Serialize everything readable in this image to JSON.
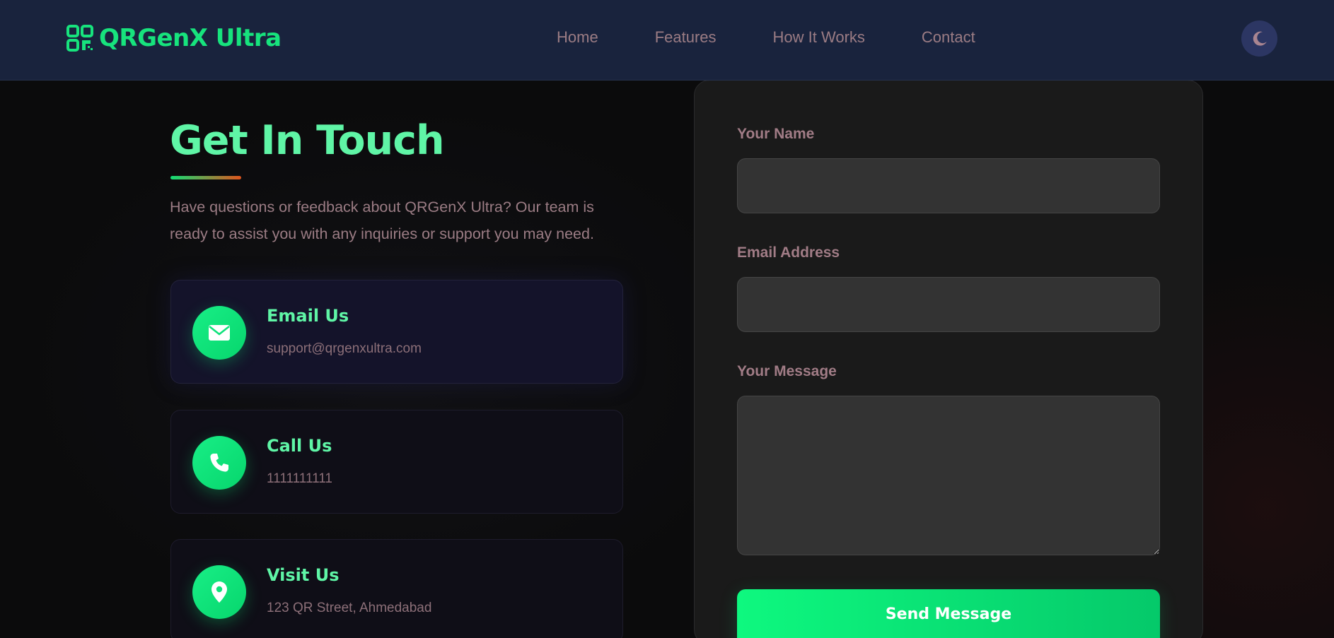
{
  "navbar": {
    "brand": "QRGenX Ultra",
    "links": [
      "Home",
      "Features",
      "How It Works",
      "Contact"
    ],
    "theme_toggle_icon": "moon-icon"
  },
  "contact": {
    "title": "Get In Touch",
    "intro": "Have questions or feedback about QRGenX Ultra? Our team is ready to assist you with any inquiries or support you may need.",
    "cards": [
      {
        "icon": "envelope-icon",
        "title": "Email Us",
        "text": "support@qrgenxultra.com"
      },
      {
        "icon": "phone-icon",
        "title": "Call Us",
        "text": "1111111111"
      },
      {
        "icon": "map-pin-icon",
        "title": "Visit Us",
        "text": "123 QR Street, Ahmedabad"
      }
    ]
  },
  "form": {
    "name_label": "Your Name",
    "name_value": "",
    "email_label": "Email Address",
    "email_value": "",
    "message_label": "Your Message",
    "message_value": "",
    "submit_label": "Send Message"
  },
  "colors": {
    "accent": "#17e37d",
    "heading": "#5ff5a6",
    "navbar_bg": "#19233d",
    "muted_text": "#9b7c84",
    "panel_bg": "#1a1a1a",
    "input_bg": "#333333"
  }
}
